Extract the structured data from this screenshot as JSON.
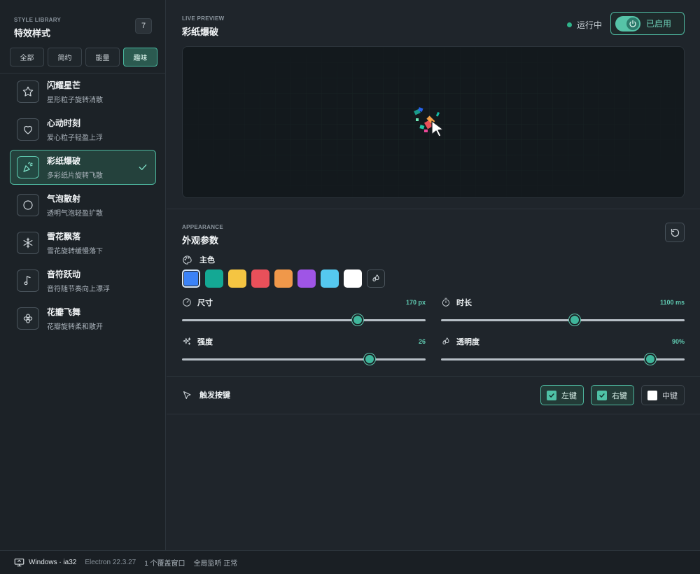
{
  "sidebar": {
    "eyebrow": "STYLE LIBRARY",
    "title": "特效样式",
    "count": "7",
    "filters": [
      {
        "label": "全部",
        "active": false
      },
      {
        "label": "简约",
        "active": false
      },
      {
        "label": "能量",
        "active": false
      },
      {
        "label": "趣味",
        "active": true
      }
    ],
    "items": [
      {
        "name": "闪耀星芒",
        "desc": "星形粒子旋转消散",
        "icon": "star-icon"
      },
      {
        "name": "心动时刻",
        "desc": "爱心粒子轻盈上浮",
        "icon": "heart-icon"
      },
      {
        "name": "彩纸爆破",
        "desc": "多彩纸片旋转飞散",
        "icon": "party-popper-icon",
        "active": true
      },
      {
        "name": "气泡散射",
        "desc": "透明气泡轻盈扩散",
        "icon": "bubble-icon"
      },
      {
        "name": "雪花飘落",
        "desc": "雪花旋转缓慢落下",
        "icon": "snowflake-icon"
      },
      {
        "name": "音符跃动",
        "desc": "音符随节奏向上漂浮",
        "icon": "music-note-icon"
      },
      {
        "name": "花瓣飞舞",
        "desc": "花瓣旋转柔和散开",
        "icon": "flower-icon"
      }
    ]
  },
  "preview": {
    "eyebrow": "LIVE PREVIEW",
    "title": "彩纸爆破",
    "run_status": "运行中",
    "enable_label": "已启用"
  },
  "appearance": {
    "eyebrow": "APPEARANCE",
    "title": "外观参数",
    "color_label": "主色",
    "swatches": [
      "#3b82f6",
      "#14a894",
      "#f5c542",
      "#e9505a",
      "#f0984a",
      "#9f55e6",
      "#55c8ef",
      "#ffffff"
    ],
    "selected_swatch": 0,
    "sliders": {
      "size": {
        "label": "尺寸",
        "value_text": "170 px",
        "fraction": 0.72
      },
      "duration": {
        "label": "时长",
        "value_text": "1100 ms",
        "fraction": 0.55
      },
      "intensity": {
        "label": "强度",
        "value_text": "26",
        "fraction": 0.77
      },
      "opacity": {
        "label": "透明度",
        "value_text": "90%",
        "fraction": 0.86
      }
    }
  },
  "trigger": {
    "label": "触发按键",
    "buttons": [
      {
        "label": "左键",
        "checked": true
      },
      {
        "label": "右键",
        "checked": true
      },
      {
        "label": "中键",
        "checked": false
      }
    ]
  },
  "statusbar": {
    "platform": "Windows · ia32",
    "electron": "Electron 22.3.27",
    "overlay": "1 个覆盖窗口",
    "monitor": "全局监听 正常"
  },
  "colors": {
    "accent": "#4db59d",
    "background": "#1f252b",
    "sidebar": "#1c2227"
  }
}
